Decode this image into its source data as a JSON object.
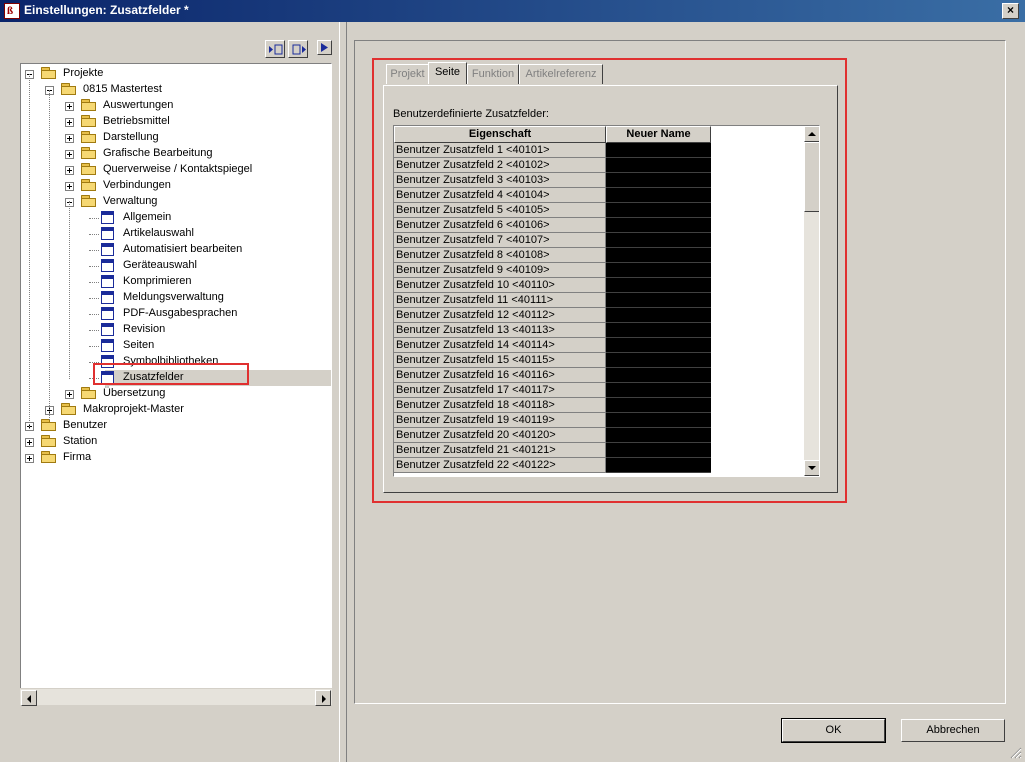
{
  "window": {
    "title": "Einstellungen: Zusatzfelder *",
    "close_glyph": "×"
  },
  "tree": {
    "nodes": [
      {
        "label": "Projekte",
        "icon": "folder-icon",
        "expander": "minus"
      },
      {
        "label": "0815 Mastertest",
        "icon": "folder-icon",
        "expander": "minus"
      },
      {
        "label": "Auswertungen",
        "icon": "folder-icon",
        "expander": "plus"
      },
      {
        "label": "Betriebsmittel",
        "icon": "folder-icon",
        "expander": "plus"
      },
      {
        "label": "Darstellung",
        "icon": "folder-icon",
        "expander": "plus"
      },
      {
        "label": "Grafische Bearbeitung",
        "icon": "folder-icon",
        "expander": "plus"
      },
      {
        "label": "Querverweise / Kontaktspiegel",
        "icon": "folder-icon",
        "expander": "plus"
      },
      {
        "label": "Verbindungen",
        "icon": "folder-icon",
        "expander": "plus"
      },
      {
        "label": "Verwaltung",
        "icon": "folder-icon",
        "expander": "minus"
      },
      {
        "label": "Allgemein",
        "icon": "settings-page-icon"
      },
      {
        "label": "Artikelauswahl",
        "icon": "settings-page-icon"
      },
      {
        "label": "Automatisiert bearbeiten",
        "icon": "settings-page-icon"
      },
      {
        "label": "Geräteauswahl",
        "icon": "settings-page-icon"
      },
      {
        "label": "Komprimieren",
        "icon": "settings-page-icon"
      },
      {
        "label": "Meldungsverwaltung",
        "icon": "settings-page-icon"
      },
      {
        "label": "PDF-Ausgabesprachen",
        "icon": "settings-page-icon"
      },
      {
        "label": "Revision",
        "icon": "settings-page-icon"
      },
      {
        "label": "Seiten",
        "icon": "settings-page-icon"
      },
      {
        "label": "Symbolbibliotheken",
        "icon": "settings-page-icon"
      },
      {
        "label": "Zusatzfelder",
        "icon": "settings-page-icon",
        "selected": true
      },
      {
        "label": "Übersetzung",
        "icon": "folder-icon",
        "expander": "plus"
      },
      {
        "label": "Makroprojekt-Master",
        "icon": "folder-icon",
        "expander": "plus"
      },
      {
        "label": "Benutzer",
        "icon": "folder-icon",
        "expander": "plus"
      },
      {
        "label": "Station",
        "icon": "folder-icon",
        "expander": "plus"
      },
      {
        "label": "Firma",
        "icon": "folder-icon",
        "expander": "plus"
      }
    ]
  },
  "tabs": [
    {
      "label": "Projekt",
      "active": false
    },
    {
      "label": "Seite",
      "active": true
    },
    {
      "label": "Funktion",
      "active": false
    },
    {
      "label": "Artikelreferenz",
      "active": false
    }
  ],
  "grid": {
    "caption": "Benutzerdefinierte Zusatzfelder:",
    "col_property": "Eigenschaft",
    "col_newname": "Neuer Name",
    "rows": [
      "Benutzer Zusatzfeld 1 <40101>",
      "Benutzer Zusatzfeld 2 <40102>",
      "Benutzer Zusatzfeld 3 <40103>",
      "Benutzer Zusatzfeld 4 <40104>",
      "Benutzer Zusatzfeld 5 <40105>",
      "Benutzer Zusatzfeld 6 <40106>",
      "Benutzer Zusatzfeld 7 <40107>",
      "Benutzer Zusatzfeld 8 <40108>",
      "Benutzer Zusatzfeld 9 <40109>",
      "Benutzer Zusatzfeld 10 <40110>",
      "Benutzer Zusatzfeld 11 <40111>",
      "Benutzer Zusatzfeld 12 <40112>",
      "Benutzer Zusatzfeld 13 <40113>",
      "Benutzer Zusatzfeld 14 <40114>",
      "Benutzer Zusatzfeld 15 <40115>",
      "Benutzer Zusatzfeld 16 <40116>",
      "Benutzer Zusatzfeld 17 <40117>",
      "Benutzer Zusatzfeld 18 <40118>",
      "Benutzer Zusatzfeld 19 <40119>",
      "Benutzer Zusatzfeld 20 <40120>",
      "Benutzer Zusatzfeld 21 <40121>",
      "Benutzer Zusatzfeld 22 <40122>"
    ]
  },
  "buttons": {
    "ok": "OK",
    "cancel": "Abbrechen"
  },
  "colors": {
    "highlight": "#e03030",
    "titlebar": "#0a246a",
    "face": "#d4d0c8"
  }
}
